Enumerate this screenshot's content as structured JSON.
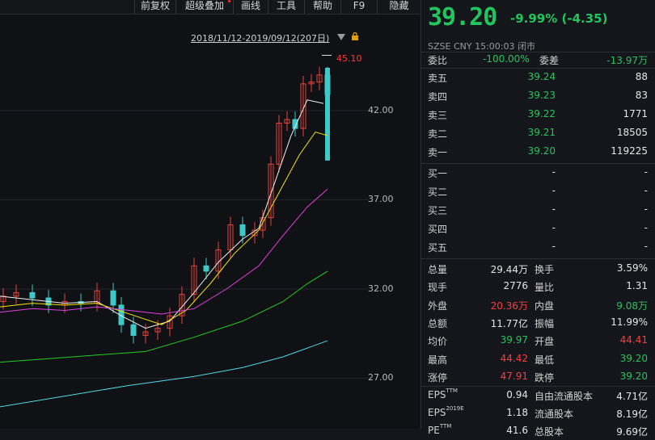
{
  "toolbar": {
    "items": [
      {
        "label": "前复权"
      },
      {
        "label": "超级叠加"
      },
      {
        "label": "画线"
      },
      {
        "label": "工具"
      },
      {
        "label": "帮助"
      },
      {
        "label": "F9"
      },
      {
        "label": "隐藏"
      }
    ]
  },
  "chart": {
    "range_label": "2018/11/12-2019/09/12(207日)",
    "high_marker": "45.10",
    "y_ticks": [
      "42.00",
      "37.00",
      "32.00",
      "27.00"
    ],
    "colors": {
      "up": "#e8423c",
      "down": "#3ec8c8",
      "ma5": "#f0f0f0",
      "ma10": "#f5e400",
      "ma20": "#e040e0",
      "ma60": "#22cc22",
      "ma120": "#4fd8e8"
    }
  },
  "quote": {
    "price": "39.20",
    "change": "-9.99% (-4.35)",
    "status": "SZSE  CNY  15:00:03  闭市",
    "wei_bi_label": "委比",
    "wei_bi_value": "-100.00%",
    "wei_cha_label": "委差",
    "wei_cha_value": "-13.97万",
    "asks": [
      {
        "label": "卖五",
        "price": "39.24",
        "vol": "88"
      },
      {
        "label": "卖四",
        "price": "39.23",
        "vol": "83"
      },
      {
        "label": "卖三",
        "price": "39.22",
        "vol": "1771"
      },
      {
        "label": "卖二",
        "price": "39.21",
        "vol": "18505"
      },
      {
        "label": "卖一",
        "price": "39.20",
        "vol": "119225"
      }
    ],
    "bids": [
      {
        "label": "买一",
        "price": "-",
        "vol": "-"
      },
      {
        "label": "买二",
        "price": "-",
        "vol": "-"
      },
      {
        "label": "买三",
        "price": "-",
        "vol": "-"
      },
      {
        "label": "买四",
        "price": "-",
        "vol": "-"
      },
      {
        "label": "买五",
        "price": "-",
        "vol": "-"
      }
    ],
    "stats": [
      {
        "l1": "总量",
        "v1": "29.44万",
        "c1": "white",
        "l2": "换手",
        "v2": "3.59%",
        "c2": "white"
      },
      {
        "l1": "现手",
        "v1": "2776",
        "c1": "white",
        "l2": "量比",
        "v2": "1.31",
        "c2": "white"
      },
      {
        "l1": "外盘",
        "v1": "20.36万",
        "c1": "red",
        "l2": "内盘",
        "v2": "9.08万",
        "c2": "green"
      },
      {
        "l1": "总额",
        "v1": "11.77亿",
        "c1": "white",
        "l2": "振幅",
        "v2": "11.99%",
        "c2": "white"
      },
      {
        "l1": "均价",
        "v1": "39.97",
        "c1": "green",
        "l2": "开盘",
        "v2": "44.41",
        "c2": "red"
      },
      {
        "l1": "最高",
        "v1": "44.42",
        "c1": "red",
        "l2": "最低",
        "v2": "39.20",
        "c2": "green"
      },
      {
        "l1": "涨停",
        "v1": "47.91",
        "c1": "red",
        "l2": "跌停",
        "v2": "39.20",
        "c2": "green"
      }
    ],
    "fin": [
      {
        "l1": "EPS",
        "sup1": "TTM",
        "v1": "0.94",
        "l2": "自由流通股本",
        "v2": "4.71亿"
      },
      {
        "l1": "EPS",
        "sup1": "2019E",
        "v1": "1.18",
        "l2": "流通股本",
        "v2": "8.19亿"
      },
      {
        "l1": "PE",
        "sup1": "TTM",
        "v1": "41.6",
        "l2": "总股本",
        "v2": "9.69亿"
      }
    ]
  }
}
